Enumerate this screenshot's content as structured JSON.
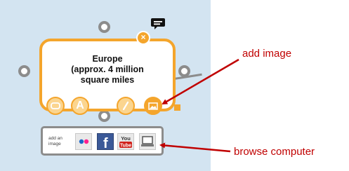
{
  "node": {
    "line1": "Europe",
    "line2": "(approx. 4 million",
    "line3": "square miles",
    "close_symbol": "×"
  },
  "toolbar": {
    "text_tool_letter": "A"
  },
  "image_bar": {
    "label": "add an image",
    "youtube_top": "You",
    "youtube_bottom": "Tube",
    "facebook_letter": "f"
  },
  "callouts": {
    "add_image": "add image",
    "browse_computer": "browse computer"
  },
  "colors": {
    "accent": "#f4a52c",
    "canvas": "#d3e4f1",
    "callout": "#c00000"
  },
  "icons": [
    "comment-icon",
    "close-icon",
    "shape-icon",
    "text-icon",
    "line-icon",
    "image-icon",
    "flickr-icon",
    "facebook-icon",
    "youtube-icon",
    "computer-icon"
  ]
}
